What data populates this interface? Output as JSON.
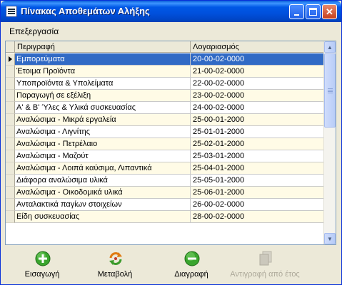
{
  "window": {
    "title": "Πίνακας Αποθεμάτων Αλήξης"
  },
  "menu": {
    "items": [
      "Επεξεργασία"
    ]
  },
  "grid": {
    "columns": [
      "Περιγραφή",
      "Λογαριασμός"
    ],
    "selected_index": 0,
    "rows": [
      {
        "desc": "Εμπορεύματα",
        "account": "20-00-02-0000"
      },
      {
        "desc": "Έτοιμα Προϊόντα",
        "account": "21-00-02-0000"
      },
      {
        "desc": "Υποπροϊόντα & Υπολείματα",
        "account": "22-00-02-0000"
      },
      {
        "desc": "Παραγωγή σε εξέλιξη",
        "account": "23-00-02-0000"
      },
      {
        "desc": "Α' & Β' Ύλες & Υλικά συσκευασίας",
        "account": "24-00-02-0000"
      },
      {
        "desc": "Αναλώσιμα - Μικρά εργαλεία",
        "account": "25-00-01-2000"
      },
      {
        "desc": "Αναλώσιμα - Λιγνίτης",
        "account": "25-01-01-2000"
      },
      {
        "desc": "Αναλώσιμα - Πετρέλαιο",
        "account": "25-02-01-2000"
      },
      {
        "desc": "Αναλώσιμα - Μαζούτ",
        "account": "25-03-01-2000"
      },
      {
        "desc": "Αναλώσιμα - Λοιπά καύσιμα, Λιπαντικά",
        "account": "25-04-01-2000"
      },
      {
        "desc": "Διάφορα αναλώσιμα υλικά",
        "account": "25-05-01-2000"
      },
      {
        "desc": "Αναλώσιμα - Οικοδομικά υλικά",
        "account": "25-06-01-2000"
      },
      {
        "desc": "Ανταλακτικά παγίων στοιχείων",
        "account": "26-00-02-0000"
      },
      {
        "desc": "Είδη συσκευασίας",
        "account": "28-00-02-0000"
      }
    ]
  },
  "toolbar": {
    "insert": "Εισαγωγή",
    "edit": "Μεταβολή",
    "delete": "Διαγραφή",
    "copy_from_year": "Αντιγραφή από έτος"
  },
  "icons": {
    "insert": "plus-circle-icon",
    "edit": "refresh-arrows-icon",
    "delete": "minus-circle-icon",
    "copy": "copy-pages-icon"
  },
  "colors": {
    "selection": "#316ac5",
    "alt_row": "#fffbe6",
    "title_bar": "#0054e3"
  }
}
